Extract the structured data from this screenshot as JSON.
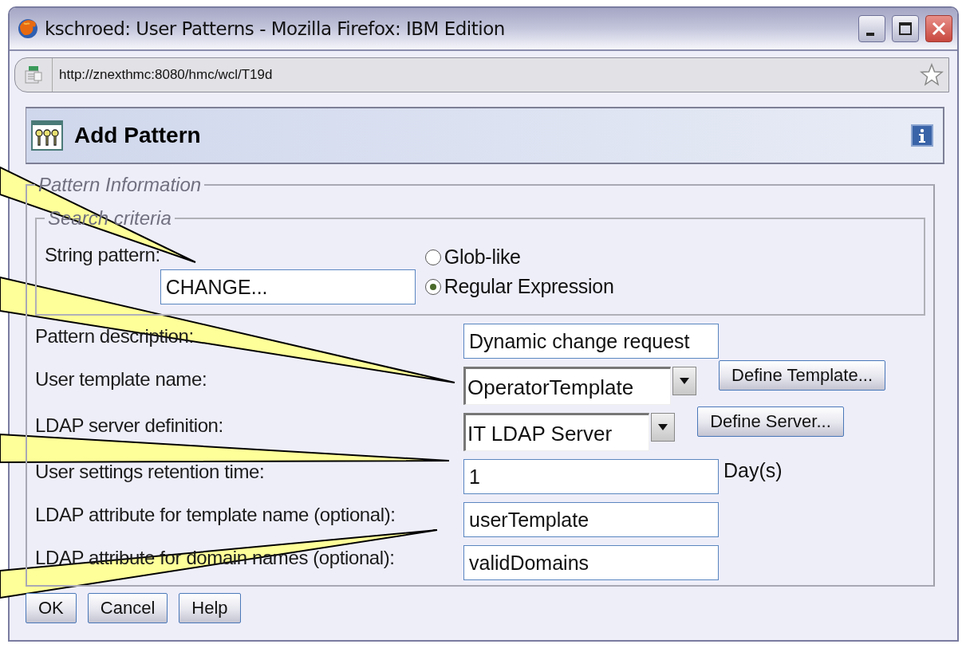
{
  "window": {
    "title": "kschroed: User Patterns - Mozilla Firefox: IBM Edition"
  },
  "address_bar": {
    "url": "http://znexthmc:8080/hmc/wcl/T19d"
  },
  "dialog": {
    "title": "Add Pattern",
    "pattern_information": {
      "legend": "Pattern Information",
      "search_criteria": {
        "legend": "Search criteria",
        "label": "String pattern:",
        "value": "CHANGE...",
        "options": [
          {
            "label": "Glob-like",
            "selected": false
          },
          {
            "label": "Regular Expression",
            "selected": true
          }
        ]
      },
      "rows": [
        {
          "kind": "text",
          "label": "Pattern description:",
          "value": "Dynamic change request"
        },
        {
          "kind": "select",
          "label": "User template name:",
          "value": "OperatorTemplate",
          "button": "Define Template..."
        },
        {
          "kind": "select",
          "label": "LDAP server definition:",
          "value": "IT LDAP Server",
          "button": "Define Server..."
        },
        {
          "kind": "text",
          "label": "User settings retention time:",
          "value": "1",
          "unit": "Day(s)"
        },
        {
          "kind": "text",
          "label": "LDAP attribute for template name (optional):",
          "value": "userTemplate"
        },
        {
          "kind": "text",
          "label": "LDAP attribute for domain names (optional):",
          "value": "validDomains"
        }
      ]
    },
    "buttons": [
      "OK",
      "Cancel",
      "Help"
    ]
  }
}
